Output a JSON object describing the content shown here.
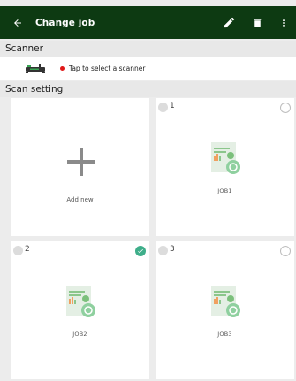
{
  "appbar": {
    "title": "Change job"
  },
  "sections": {
    "scanner": "Scanner",
    "scan_setting": "Scan setting"
  },
  "scanner": {
    "hint": "Tap to select a scanner"
  },
  "add_tile": {
    "label": "Add new"
  },
  "jobs": [
    {
      "number": "1",
      "label": "JOB1",
      "selected": false
    },
    {
      "number": "2",
      "label": "JOB2",
      "selected": true
    },
    {
      "number": "3",
      "label": "JOB3",
      "selected": false
    }
  ],
  "colors": {
    "appbar": "#0d3a12",
    "accent": "#3fae8a",
    "status_dot": "#e01919"
  },
  "icons": [
    "back-arrow-icon",
    "pencil-icon",
    "trash-icon",
    "more-vert-icon",
    "scanner-icon",
    "plus-icon",
    "document-icon",
    "check-icon"
  ]
}
